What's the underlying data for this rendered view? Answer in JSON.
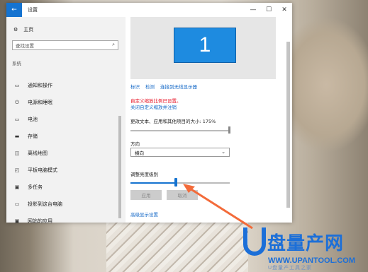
{
  "window": {
    "title": "设置",
    "back_glyph": "←",
    "minimize_glyph": "—",
    "maximize_glyph": "☐",
    "close_glyph": "✕"
  },
  "sidebar": {
    "home_label": "主页",
    "search_placeholder": "查找设置",
    "section": "系统",
    "items": [
      {
        "label": "通知和操作",
        "icon": "notification-icon",
        "glyph": "▭"
      },
      {
        "label": "电源和睡眠",
        "icon": "power-icon",
        "glyph": "⏻"
      },
      {
        "label": "电池",
        "icon": "battery-icon",
        "glyph": "▭"
      },
      {
        "label": "存储",
        "icon": "storage-icon",
        "glyph": "▬"
      },
      {
        "label": "离线地图",
        "icon": "map-icon",
        "glyph": "◫"
      },
      {
        "label": "平板电脑模式",
        "icon": "tablet-icon",
        "glyph": "◰"
      },
      {
        "label": "多任务",
        "icon": "multitask-icon",
        "glyph": "▣"
      },
      {
        "label": "投影到这台电脑",
        "icon": "project-icon",
        "glyph": "▭"
      },
      {
        "label": "网站的应用",
        "icon": "web-apps-icon",
        "glyph": "▣"
      }
    ]
  },
  "display": {
    "monitor_number": "1",
    "links": [
      "标识",
      "检测",
      "连接到无线显示器"
    ],
    "warning": "自定义缩放比例已设置。",
    "warning_link": "关闭自定义缩放并注销",
    "scale_label": "更改文本、应用和其他项目的大小: 175%",
    "orientation_label": "方向",
    "orientation_value": "横向",
    "brightness_label": "调整亮度级别",
    "brightness_level": 0.46,
    "apply_label": "应用",
    "cancel_label": "取消",
    "advanced_link": "高级显示设置"
  },
  "watermark": {
    "brand": "盘量产网",
    "url": "WWW.UPANTOOL.COM",
    "sub": "U盘量产工具之家"
  },
  "colors": {
    "accent": "#1573d0",
    "link": "#1569c7",
    "warning": "#e81123",
    "annotation_arrow": "#f36b3a"
  }
}
